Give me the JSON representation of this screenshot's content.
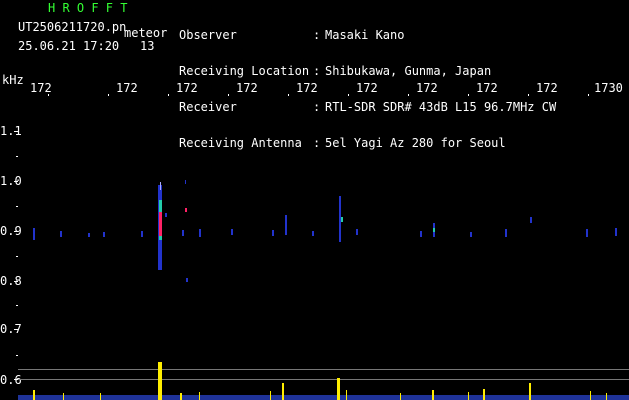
{
  "header": {
    "logo": "H R O F F T",
    "filename": "UT2506211720.pn",
    "detection_label": "meteor",
    "datetime": "25.06.21 17:20",
    "count": "13"
  },
  "info": [
    {
      "key": "Observer",
      "value": "Masaki Kano"
    },
    {
      "key": "Receiving Location",
      "value": "Shibukawa, Gunma, Japan"
    },
    {
      "key": "Receiver",
      "value": "RTL-SDR SDR# 43dB L15 96.7MHz CW"
    },
    {
      "key": "Receiving Antenna",
      "value": "5el Yagi Az 280 for Seoul"
    }
  ],
  "axis": {
    "unit": "kHz",
    "time_ticks": [
      "172",
      "172",
      "172",
      "172",
      "172",
      "172",
      "172",
      "172",
      "172",
      "1730"
    ],
    "freq_ticks": [
      "1.1",
      "1.0",
      "0.9",
      "0.8",
      "0.7",
      "0.6"
    ]
  },
  "colors": {
    "background": "#000000",
    "logo": "#33ff33",
    "text": "#ffffff",
    "signal_base": "#2233cc",
    "meteor_core": "#ff2266",
    "amplitude": "#ffee00"
  }
}
